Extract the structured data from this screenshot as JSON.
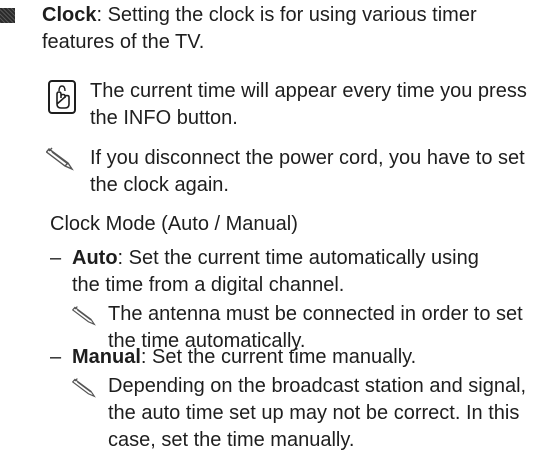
{
  "clock": {
    "label": "Clock",
    "description": ": Setting the clock is for using various timer features of the TV."
  },
  "note_info": {
    "icon": "remote-button-icon",
    "text_before": "The current time will appear every time you press the ",
    "button_name": "INFO",
    "text_after": " button."
  },
  "note_power": {
    "icon": "pencil-note-icon",
    "text": "If you disconnect the power cord, you have to set the clock again."
  },
  "clock_mode": {
    "heading": "Clock Mode (Auto / Manual)",
    "auto": {
      "dash": "–",
      "label": "Auto",
      "description": ": Set the current time automatically using the time from a digital channel.",
      "note": "The antenna must be connected in order to set the time automatically."
    },
    "manual": {
      "dash": "–",
      "label": "Manual",
      "description": ": Set the current time manually.",
      "note": "Depending on the broadcast station and signal, the auto time set up may not be correct. In this case, set the time manually."
    }
  }
}
